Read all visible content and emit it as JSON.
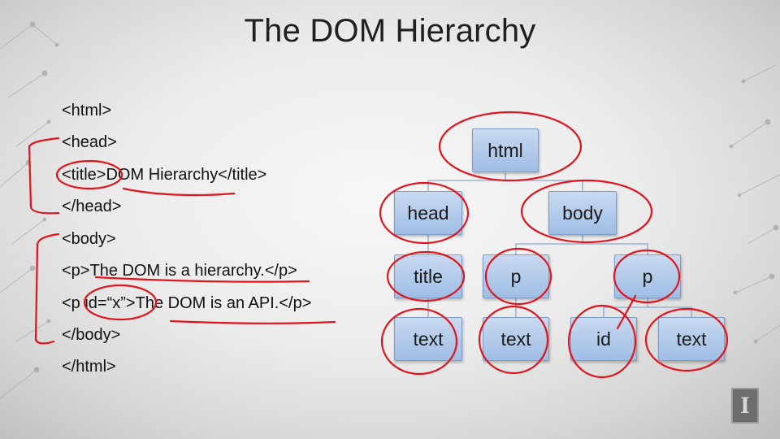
{
  "slide": {
    "title": "The DOM Hierarchy"
  },
  "code_lines": [
    "<html>",
    "<head>",
    "<title>DOM Hierarchy</title>",
    "</head>",
    "<body>",
    "<p>The DOM is a hierarchy.</p>",
    "<p id=“x”>The DOM is an API.</p>",
    "</body>",
    "</html>"
  ],
  "tree": {
    "root": "html",
    "level1": [
      "head",
      "body"
    ],
    "level2": [
      "title",
      "p",
      "p"
    ],
    "level3": [
      "text",
      "text",
      "id",
      "text"
    ]
  },
  "colors": {
    "node_fill": "#b4cdeb",
    "annotation": "#e0141c"
  },
  "logo": {
    "glyph": "I"
  }
}
